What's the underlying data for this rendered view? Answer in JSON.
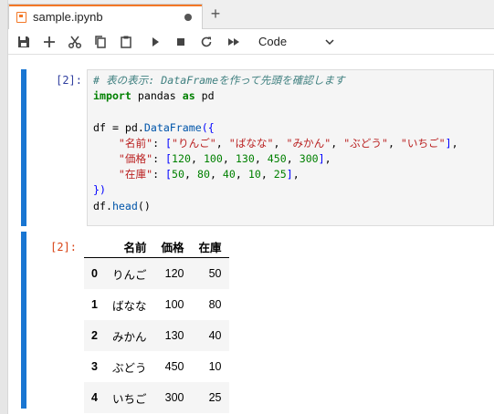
{
  "tab": {
    "title": "sample.ipynb",
    "add_label": "+"
  },
  "toolbar": {
    "buttons": [
      "save-icon",
      "add-cell-icon",
      "cut-icon",
      "copy-icon",
      "paste-icon",
      "run-icon",
      "stop-icon",
      "restart-icon",
      "fast-forward-icon"
    ],
    "cell_type": "Code"
  },
  "cells": [
    {
      "prompt": "[2]:",
      "code_lines": [
        "# 表の表示: DataFrameを作って先頭を確認します",
        "import pandas as pd",
        "",
        "df = pd.DataFrame({",
        "    \"名前\": [\"りんご\", \"ばなな\", \"みかん\", \"ぶどう\", \"いちご\"],",
        "    \"価格\": [120, 100, 130, 450, 300],",
        "    \"在庫\": [50, 80, 40, 10, 25],",
        "})",
        "df.head()"
      ]
    }
  ],
  "output": {
    "prompt": "[2]:",
    "table": {
      "columns": [
        "",
        "名前",
        "価格",
        "在庫"
      ],
      "rows": [
        [
          "0",
          "りんご",
          "120",
          "50"
        ],
        [
          "1",
          "ばなな",
          "100",
          "80"
        ],
        [
          "2",
          "みかん",
          "130",
          "40"
        ],
        [
          "3",
          "ぶどう",
          "450",
          "10"
        ],
        [
          "4",
          "いちご",
          "300",
          "25"
        ]
      ]
    }
  },
  "colors": {
    "accent": "#f37726",
    "cell_bar": "#1976d2",
    "in_prompt": "#303f9f",
    "out_prompt": "#d84315"
  }
}
